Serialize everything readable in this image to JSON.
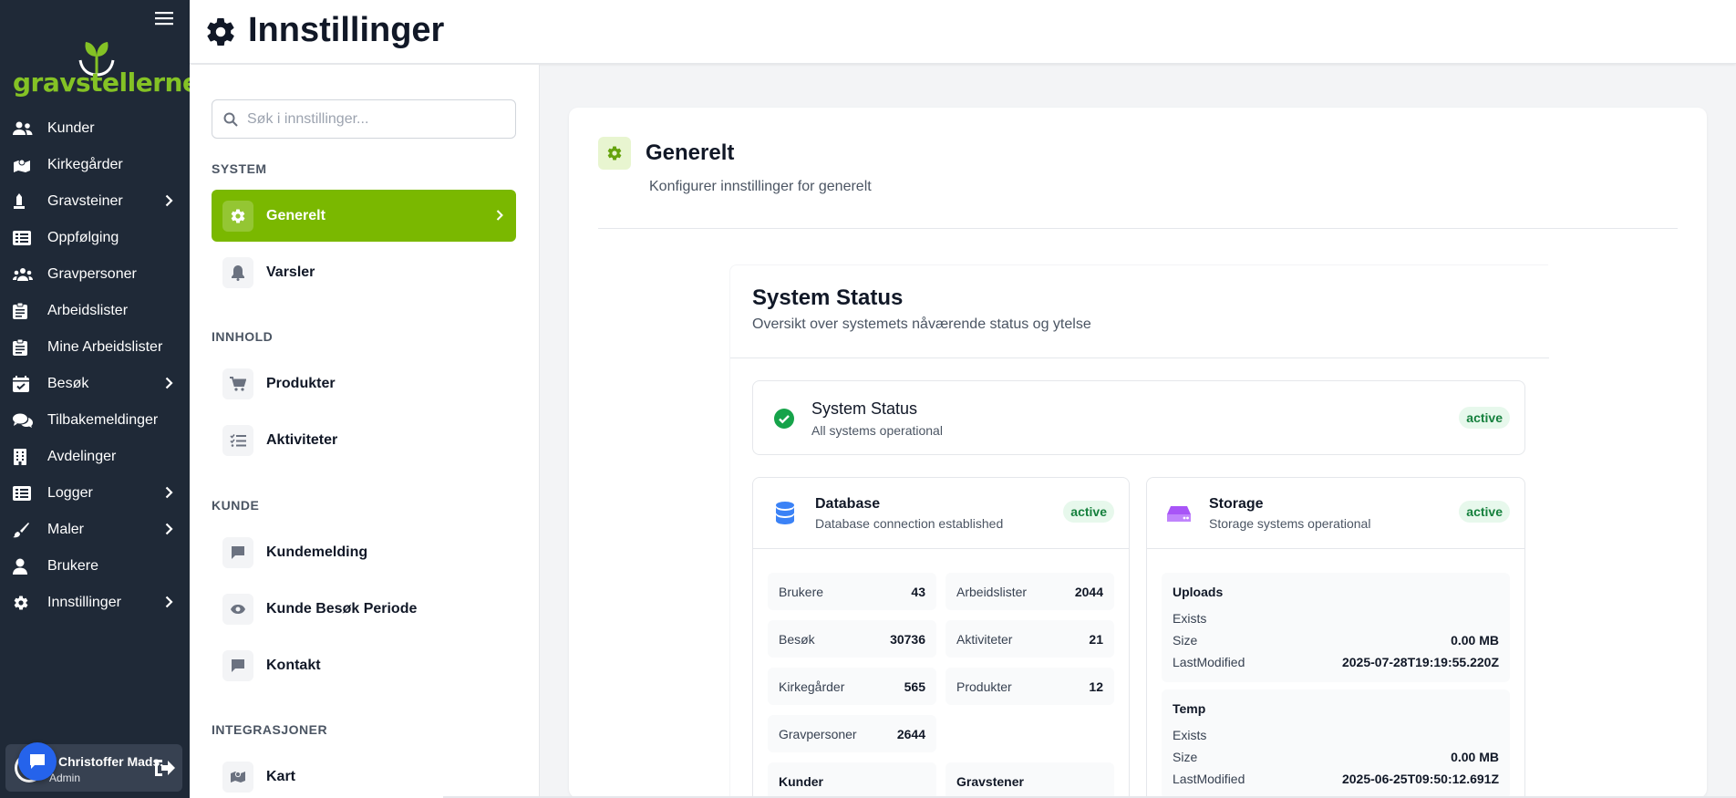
{
  "app": {
    "brand": "gravstellerne",
    "brand_color": "#84c225"
  },
  "sidebar": {
    "items": [
      {
        "label": "Kunder",
        "icon": "users-icon",
        "has_children": false
      },
      {
        "label": "Kirkegårder",
        "icon": "map-icon",
        "has_children": false
      },
      {
        "label": "Gravsteiner",
        "icon": "monument-icon",
        "has_children": true
      },
      {
        "label": "Oppfølging",
        "icon": "list-icon",
        "has_children": false
      },
      {
        "label": "Gravpersoner",
        "icon": "users-group-icon",
        "has_children": false
      },
      {
        "label": "Arbeidslister",
        "icon": "clipboard-icon",
        "has_children": false
      },
      {
        "label": "Mine Arbeidslister",
        "icon": "clipboard-icon",
        "has_children": false
      },
      {
        "label": "Besøk",
        "icon": "calendar-check-icon",
        "has_children": true
      },
      {
        "label": "Tilbakemeldinger",
        "icon": "comments-icon",
        "has_children": false
      },
      {
        "label": "Avdelinger",
        "icon": "building-icon",
        "has_children": false
      },
      {
        "label": "Logger",
        "icon": "list-icon",
        "has_children": true
      },
      {
        "label": "Maler",
        "icon": "brush-icon",
        "has_children": true
      },
      {
        "label": "Brukere",
        "icon": "user-icon",
        "has_children": false
      },
      {
        "label": "Innstillinger",
        "icon": "gear-icon",
        "has_children": true
      }
    ],
    "user": {
      "name": "Christoffer Mads...",
      "role": "Admin"
    }
  },
  "header": {
    "title": "Innstillinger"
  },
  "settings_nav": {
    "search_placeholder": "Søk i innstillinger...",
    "sections": [
      {
        "title": "SYSTEM",
        "items": [
          {
            "label": "Generelt",
            "active": true
          },
          {
            "label": "Varsler",
            "active": false
          }
        ]
      },
      {
        "title": "INNHOLD",
        "items": [
          {
            "label": "Produkter"
          },
          {
            "label": "Aktiviteter"
          }
        ]
      },
      {
        "title": "KUNDE",
        "items": [
          {
            "label": "Kundemelding"
          },
          {
            "label": "Kunde Besøk Periode"
          },
          {
            "label": "Kontakt"
          }
        ]
      },
      {
        "title": "INTEGRASJONER",
        "items": [
          {
            "label": "Kart"
          }
        ]
      }
    ]
  },
  "content": {
    "title": "Generelt",
    "subtitle": "Konfigurer innstillinger for generelt",
    "system_status": {
      "title": "System Status",
      "subtitle": "Oversikt over systemets nåværende status og ytelse",
      "overall": {
        "title": "System Status",
        "desc": "All systems operational",
        "badge": "active"
      },
      "database": {
        "title": "Database",
        "desc": "Database connection established",
        "badge": "active",
        "stats": [
          {
            "label": "Brukere",
            "value": "43"
          },
          {
            "label": "Arbeidslister",
            "value": "2044"
          },
          {
            "label": "Besøk",
            "value": "30736"
          },
          {
            "label": "Aktiviteter",
            "value": "21"
          },
          {
            "label": "Kirkegårder",
            "value": "565"
          },
          {
            "label": "Produkter",
            "value": "12"
          },
          {
            "label": "Gravpersoner",
            "value": "2644"
          }
        ],
        "sub_headers": [
          "Kunder",
          "Gravstener"
        ]
      },
      "storage": {
        "title": "Storage",
        "desc": "Storage systems operational",
        "badge": "active",
        "entries": [
          {
            "name": "Uploads",
            "exists_label": "Exists",
            "size_label": "Size",
            "size": "0.00 MB",
            "modified_label": "LastModified",
            "modified": "2025-07-28T19:19:55.220Z"
          },
          {
            "name": "Temp",
            "exists_label": "Exists",
            "size_label": "Size",
            "size": "0.00 MB",
            "modified_label": "LastModified",
            "modified": "2025-06-25T09:50:12.691Z"
          }
        ]
      }
    }
  },
  "colors": {
    "sidebar_bg": "#1f2937",
    "accent_green": "#7ab800",
    "status_green": "#16a34a",
    "db_blue": "#3b82f6",
    "storage_purple": "#a855f7"
  }
}
